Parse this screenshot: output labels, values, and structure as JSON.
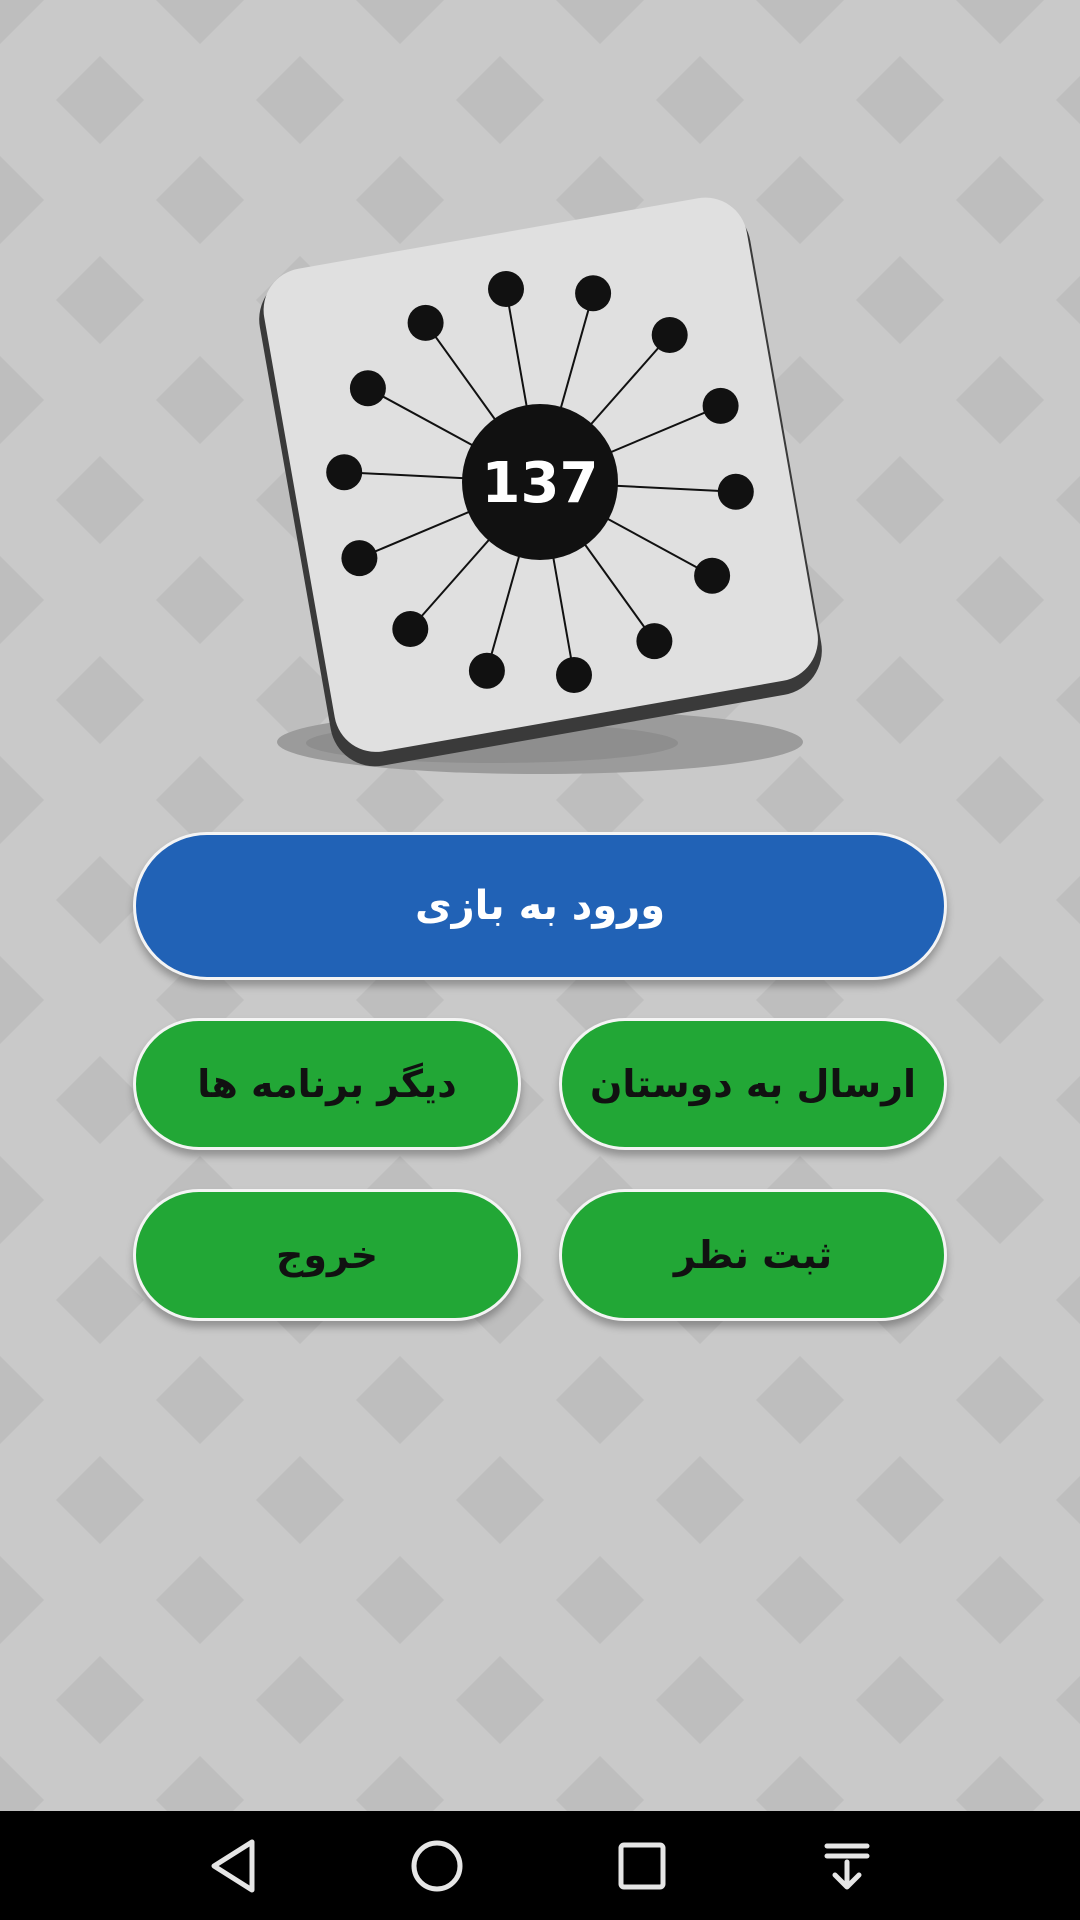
{
  "logo": {
    "score": "137",
    "pin_count": 14
  },
  "menu": {
    "play_label": "ورود به بازی",
    "send_to_friends_label": "ارسال به دوستان",
    "other_apps_label": "دیگر برنامه ها",
    "rate_label": "ثبت نظر",
    "exit_label": "خروج"
  },
  "navbar": {
    "back_icon": "back-triangle-icon",
    "home_icon": "home-circle-icon",
    "recents_icon": "recents-square-icon",
    "notifications_icon": "pull-down-notifications-icon"
  },
  "colors": {
    "background": "#c9c9c9",
    "diamond": "#bebebe",
    "card_face": "#e0e0e0",
    "card_edge": "#3a3a3a",
    "pin": "#111111",
    "primary_button": "#2162b6",
    "primary_text": "#ffffff",
    "secondary_button": "#22a736",
    "secondary_text": "#111111",
    "navbar": "#000000",
    "nav_icon": "#e6e6e6"
  }
}
